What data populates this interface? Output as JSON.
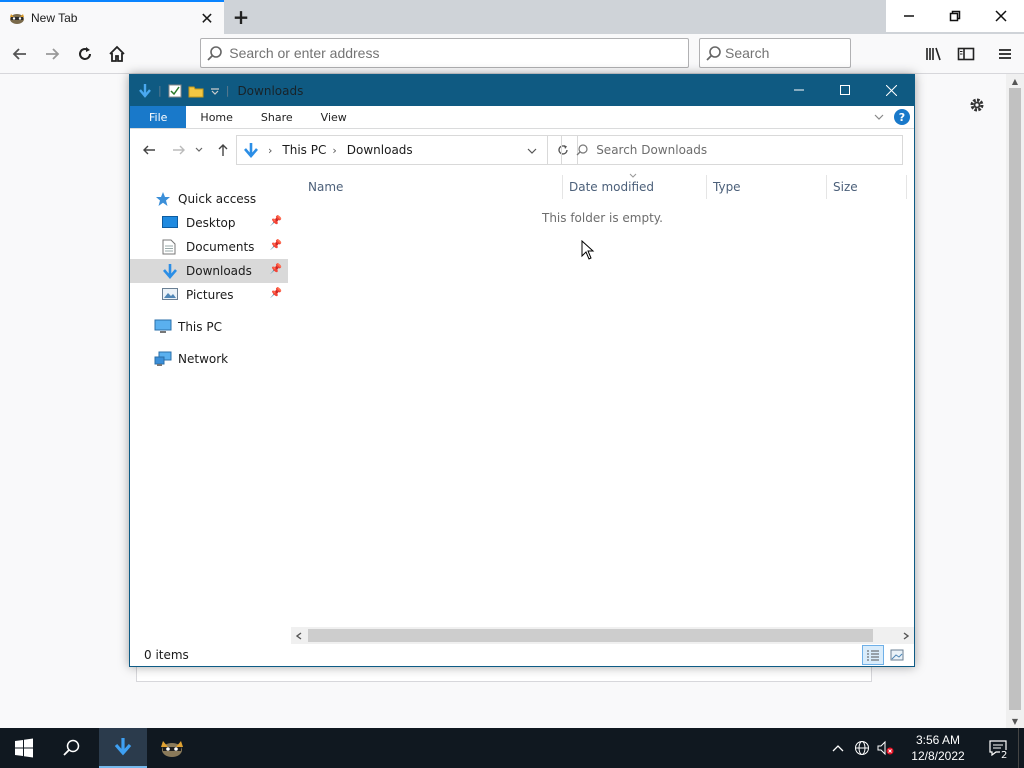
{
  "browser": {
    "tab_title": "New Tab",
    "url_placeholder": "Search or enter address",
    "search_placeholder": "Search",
    "accent": "#0a84ff"
  },
  "explorer": {
    "window_title": "Downloads",
    "ribbon_tabs": [
      "File",
      "Home",
      "Share",
      "View"
    ],
    "help_label": "?",
    "breadcrumb": [
      "This PC",
      "Downloads"
    ],
    "search_placeholder": "Search Downloads",
    "nav": {
      "quick_access": "Quick access",
      "desktop": "Desktop",
      "documents": "Documents",
      "downloads": "Downloads",
      "pictures": "Pictures",
      "this_pc": "This PC",
      "network": "Network"
    },
    "columns": {
      "name": "Name",
      "date_modified": "Date modified",
      "type": "Type",
      "size": "Size"
    },
    "empty_message": "This folder is empty.",
    "status_count": "0 items",
    "title_bar_color": "#0f5a82",
    "file_tab_color": "#1979ca"
  },
  "taskbar": {
    "time": "3:56 AM",
    "date": "12/8/2022",
    "notification_count": "2"
  }
}
